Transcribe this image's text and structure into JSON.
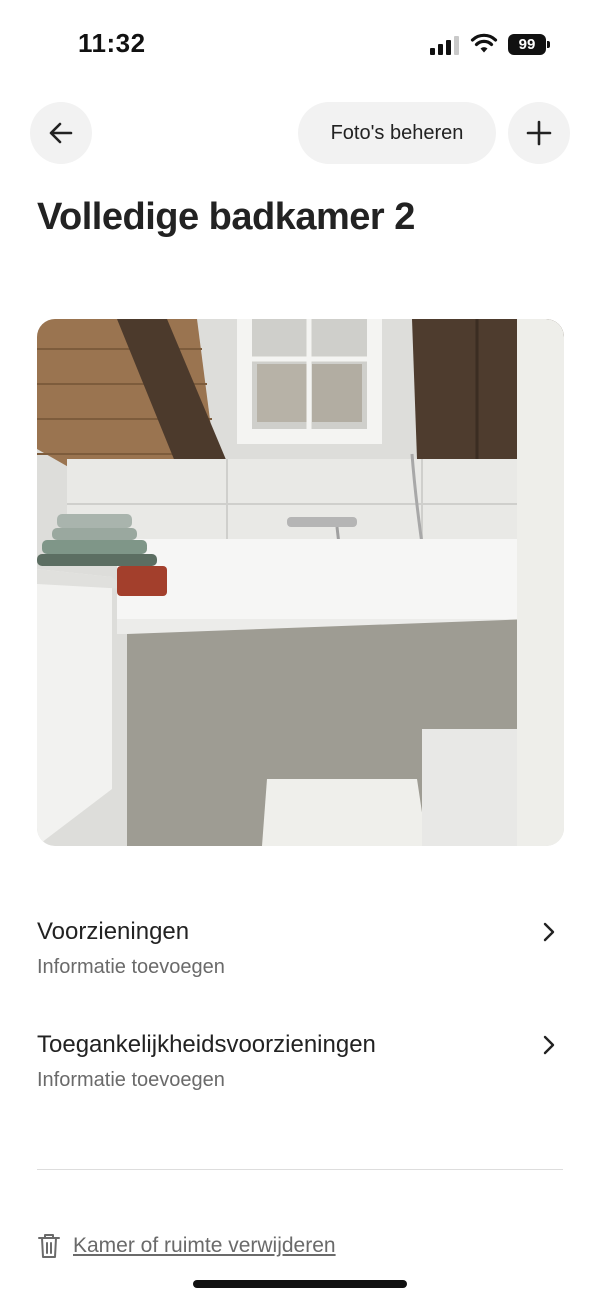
{
  "status_bar": {
    "time": "11:32",
    "battery": "99"
  },
  "nav": {
    "back_icon": "arrow-left-icon",
    "manage_photos_label": "Foto's beheren",
    "add_icon": "plus-icon"
  },
  "page": {
    "title": "Volledige badkamer 2"
  },
  "photo": {
    "subject": "bathroom-photo"
  },
  "sections": [
    {
      "title": "Voorzieningen",
      "subtitle": "Informatie toevoegen"
    },
    {
      "title": "Toegankelijkheidsvoorzieningen",
      "subtitle": "Informatie toevoegen"
    }
  ],
  "delete": {
    "icon": "trash-icon",
    "label": "Kamer of ruimte verwijderen"
  },
  "colors": {
    "text_primary": "#222222",
    "text_secondary": "#6a6a6a",
    "button_bg": "#f2f2f2",
    "divider": "#dddddd"
  }
}
